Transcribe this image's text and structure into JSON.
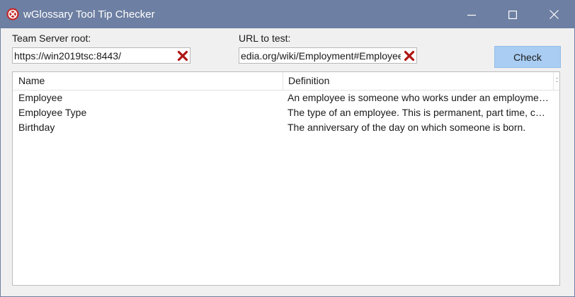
{
  "window": {
    "title": "wGlossary Tool Tip Checker"
  },
  "form": {
    "root_label": "Team Server root:",
    "root_value": "https://win2019tsc:8443/",
    "url_label": "URL to test:",
    "url_value": "edia.org/wiki/Employment#Employee",
    "check_label": "Check"
  },
  "grid": {
    "columns": [
      "Name",
      "Definition"
    ],
    "extra_column": ":",
    "rows": [
      {
        "name": "Employee",
        "definition": "An employee is someone who works under an employment contract for an employer."
      },
      {
        "name": "Employee Type",
        "definition": "The type of an employee. This is permanent, part time, contractor or temporary."
      },
      {
        "name": "Birthday",
        "definition": "The anniversary of the day on which someone is born."
      }
    ]
  },
  "colors": {
    "titlebar": "#6d7fa2",
    "check_button": "#a9cdf3",
    "clear_icon": "#b01515"
  },
  "icons": {
    "app": "app-logo-icon",
    "minimize": "minimize-icon",
    "maximize": "maximize-icon",
    "close": "close-icon",
    "clear": "clear-x-icon"
  }
}
